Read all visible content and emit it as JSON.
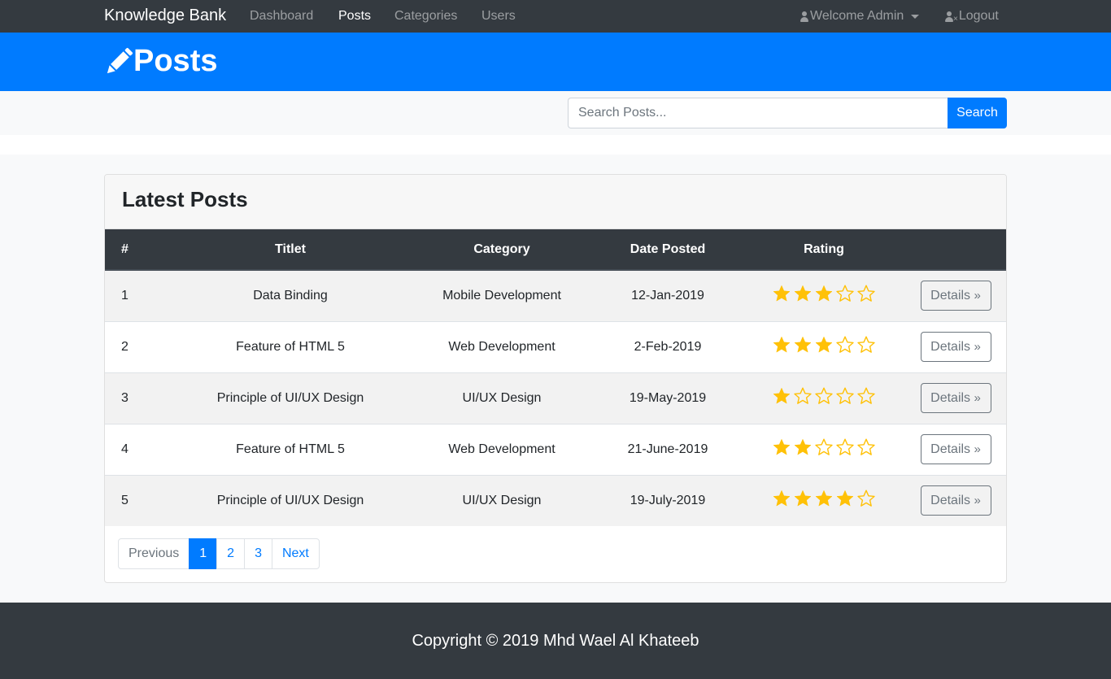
{
  "nav": {
    "brand": "Knowledge Bank",
    "links": [
      "Dashboard",
      "Posts",
      "Categories",
      "Users"
    ],
    "active_link": "Posts",
    "welcome": "Welcome Admin",
    "logout": "Logout"
  },
  "header": {
    "title": "Posts",
    "icon": "pencil-icon"
  },
  "search": {
    "placeholder": "Search Posts...",
    "button": "Search"
  },
  "card": {
    "title": "Latest Posts",
    "columns": [
      "#",
      "Titlet",
      "Category",
      "Date Posted",
      "Rating",
      ""
    ],
    "rows": [
      {
        "num": "1",
        "title": "Data Binding",
        "category": "Mobile Development",
        "date": "12-Jan-2019",
        "rating": 3,
        "action": "Details"
      },
      {
        "num": "2",
        "title": "Feature of HTML 5",
        "category": "Web Development",
        "date": "2-Feb-2019",
        "rating": 3,
        "action": "Details"
      },
      {
        "num": "3",
        "title": "Principle of UI/UX Design",
        "category": "UI/UX Design",
        "date": "19-May-2019",
        "rating": 1,
        "action": "Details"
      },
      {
        "num": "4",
        "title": "Feature of HTML 5",
        "category": "Web Development",
        "date": "21-June-2019",
        "rating": 2,
        "action": "Details"
      },
      {
        "num": "5",
        "title": "Principle of UI/UX Design",
        "category": "UI/UX Design",
        "date": "19-July-2019",
        "rating": 4,
        "action": "Details"
      }
    ],
    "rating_max": 5
  },
  "pagination": {
    "previous": "Previous",
    "pages": [
      "1",
      "2",
      "3"
    ],
    "active_page": "1",
    "next": "Next"
  },
  "footer": {
    "text": "Copyright © 2019 Mhd Wael Al Khateeb"
  },
  "colors": {
    "primary": "#007bff",
    "dark": "#343a40",
    "star": "#ffc107"
  }
}
